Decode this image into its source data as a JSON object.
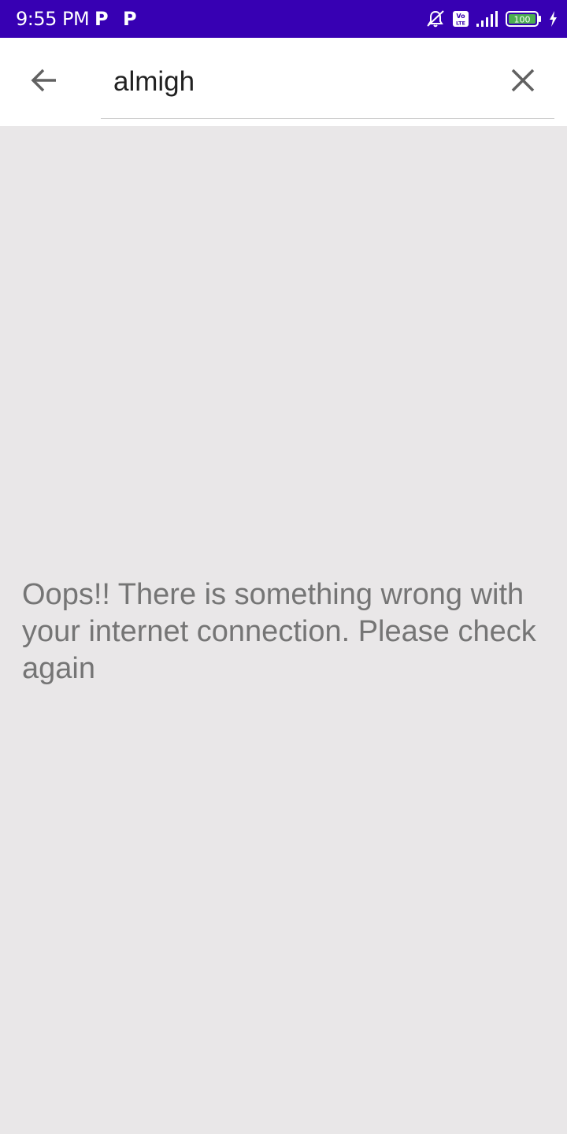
{
  "status_bar": {
    "time": "9:55 PM",
    "notif_1": "P",
    "notif_2": "P",
    "network_badge": "Vo LTE",
    "battery": "100",
    "icons": [
      "mute-bell-icon",
      "volte-icon",
      "signal-icon",
      "battery-icon",
      "charging-icon"
    ]
  },
  "search": {
    "value": "almigh",
    "back_icon": "arrow-back-icon",
    "clear_icon": "close-icon"
  },
  "message": {
    "error": "Oops!! There is something wrong with your internet connection. Please check again"
  },
  "colors": {
    "status_bar": "#3700b3",
    "app_bar": "#ffffff",
    "background": "#e9e7e8",
    "message_text": "#757575"
  }
}
